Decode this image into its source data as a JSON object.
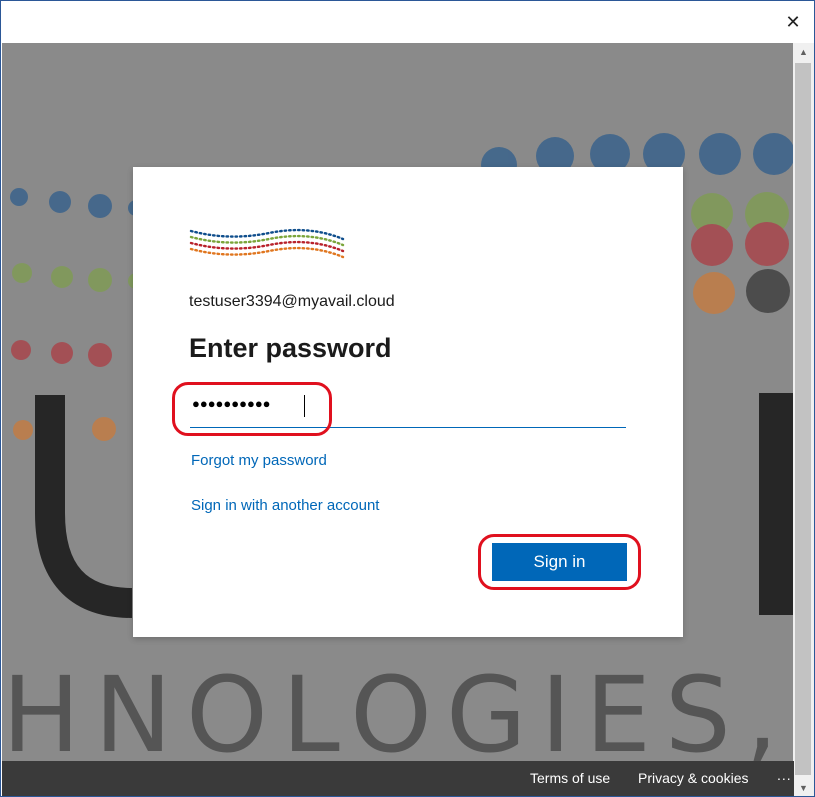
{
  "window": {
    "close_glyph": "✕"
  },
  "signin_dialog": {
    "identity": "testuser3394@myavail.cloud",
    "heading": "Enter password",
    "password_masked": "●●●●●●●●●●",
    "forgot_link": "Forgot my password",
    "another_account_link": "Sign in with another account",
    "signin_button": "Sign in"
  },
  "footer": {
    "terms": "Terms of use",
    "privacy": "Privacy & cookies",
    "more": "..."
  },
  "background": {
    "company_text": "HNOLOGIES,"
  },
  "colors": {
    "accent": "#0067b8",
    "highlight": "#e0101e",
    "dot_blue": "#0f4e8c",
    "dot_green": "#7aa53a",
    "dot_red": "#b8222b",
    "dot_orange": "#e0761f"
  }
}
